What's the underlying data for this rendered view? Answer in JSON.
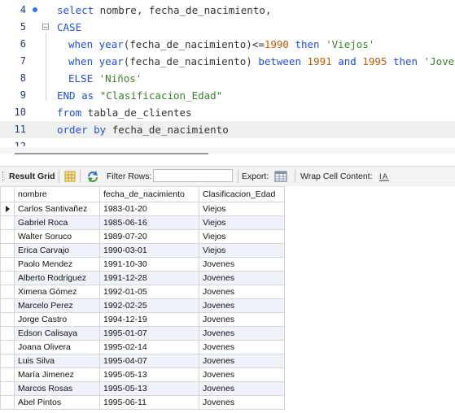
{
  "editor": {
    "lines": [
      {
        "num": "4",
        "tokens": [
          {
            "t": "kw",
            "v": "select"
          },
          {
            "t": "id",
            "v": " nombre, fecha_de_nacimiento,"
          }
        ]
      },
      {
        "num": "5",
        "tokens": [
          {
            "t": "kw",
            "v": "CASE"
          }
        ]
      },
      {
        "num": "6",
        "tokens": [
          {
            "t": "kw",
            "v": "when "
          },
          {
            "t": "fn",
            "v": "year"
          },
          {
            "t": "id",
            "v": "(fecha_de_nacimiento)<="
          },
          {
            "t": "num",
            "v": "1990"
          },
          {
            "t": "id",
            "v": " "
          },
          {
            "t": "kw",
            "v": "then"
          },
          {
            "t": "id",
            "v": " "
          },
          {
            "t": "str",
            "v": "'Viejos'"
          }
        ]
      },
      {
        "num": "7",
        "tokens": [
          {
            "t": "kw",
            "v": "when "
          },
          {
            "t": "fn",
            "v": "year"
          },
          {
            "t": "id",
            "v": "(fecha_de_nacimiento) "
          },
          {
            "t": "kw",
            "v": "between"
          },
          {
            "t": "id",
            "v": " "
          },
          {
            "t": "num",
            "v": "1991"
          },
          {
            "t": "id",
            "v": " "
          },
          {
            "t": "kw",
            "v": "and"
          },
          {
            "t": "id",
            "v": " "
          },
          {
            "t": "num",
            "v": "1995"
          },
          {
            "t": "id",
            "v": " "
          },
          {
            "t": "kw",
            "v": "then"
          },
          {
            "t": "id",
            "v": " "
          },
          {
            "t": "str",
            "v": "'Jovenes'"
          }
        ]
      },
      {
        "num": "8",
        "tokens": [
          {
            "t": "kw",
            "v": "ELSE"
          },
          {
            "t": "id",
            "v": " "
          },
          {
            "t": "str",
            "v": "'Niños'"
          }
        ]
      },
      {
        "num": "9",
        "tokens": [
          {
            "t": "kw",
            "v": "END as"
          },
          {
            "t": "id",
            "v": " "
          },
          {
            "t": "str",
            "v": "\"Clasificacion_Edad\""
          }
        ]
      },
      {
        "num": "10",
        "tokens": [
          {
            "t": "kw",
            "v": "from"
          },
          {
            "t": "id",
            "v": " tabla_de_clientes"
          }
        ]
      },
      {
        "num": "11",
        "tokens": [
          {
            "t": "kw",
            "v": "order by"
          },
          {
            "t": "id",
            "v": " fecha_de_nacimiento"
          }
        ]
      },
      {
        "num": "12",
        "tokens": []
      }
    ]
  },
  "toolbar": {
    "result_grid_label": "Result Grid",
    "filter_rows_label": "Filter Rows:",
    "filter_value": "",
    "export_label": "Export:",
    "wrap_label": "Wrap Cell Content:"
  },
  "grid": {
    "columns": [
      "nombre",
      "fecha_de_nacimiento",
      "Clasificacion_Edad"
    ],
    "rows": [
      [
        "Carlos Santivañez",
        "1983-01-20",
        "Viejos"
      ],
      [
        "Gabriel Roca",
        "1985-06-16",
        "Viejos"
      ],
      [
        "Walter Soruco",
        "1989-07-20",
        "Viejos"
      ],
      [
        "Erica Carvajo",
        "1990-03-01",
        "Viejos"
      ],
      [
        "Paolo Mendez",
        "1991-10-30",
        "Jovenes"
      ],
      [
        "Alberto Rodriguez",
        "1991-12-28",
        "Jovenes"
      ],
      [
        "Ximena Gómez",
        "1992-01-05",
        "Jovenes"
      ],
      [
        "Marcelo Perez",
        "1992-02-25",
        "Jovenes"
      ],
      [
        "Jorge Castro",
        "1994-12-19",
        "Jovenes"
      ],
      [
        "Edson Calisaya",
        "1995-01-07",
        "Jovenes"
      ],
      [
        "Joana Olivera",
        "1995-02-14",
        "Jovenes"
      ],
      [
        "Luis Silva",
        "1995-04-07",
        "Jovenes"
      ],
      [
        "María Jimenez",
        "1995-05-13",
        "Jovenes"
      ],
      [
        "Marcos Rosas",
        "1995-05-13",
        "Jovenes"
      ],
      [
        "Abel Pintos",
        "1995-06-11",
        "Jovenes"
      ]
    ]
  },
  "icons": {
    "grid_view": "grid-view-icon",
    "refresh": "refresh-icon",
    "export": "export-icon",
    "wrap": "wrap-cell-icon",
    "current_row": "current-row-pointer-icon"
  },
  "colors": {
    "keyword": "#1d4fd6",
    "string": "#3b7f2e",
    "number": "#c05a00",
    "alt_row": "#eef3fb"
  }
}
